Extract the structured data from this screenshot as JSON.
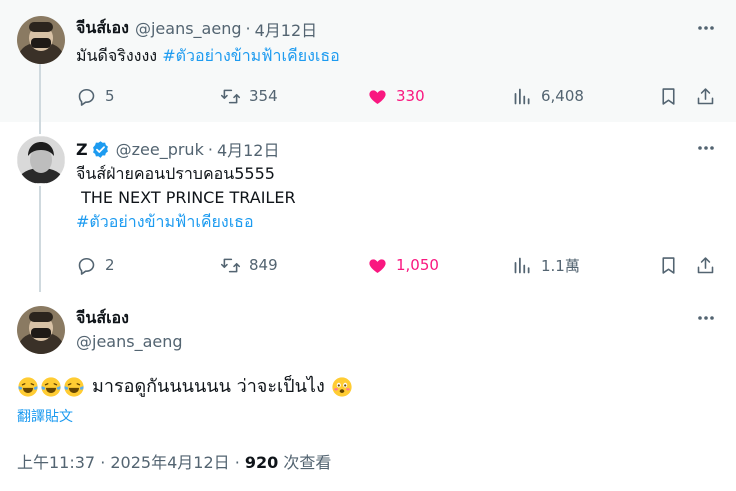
{
  "reply1": {
    "name": "จีนส์เอง",
    "handle": "@jeans_aeng",
    "date": "4月12日",
    "text": "มันดีจริงงงง",
    "hashtag": "#ตัวอย่างข้ามฟ้าเคียงเธอ",
    "replies": "5",
    "reposts": "354",
    "likes": "330",
    "views": "6,408"
  },
  "reply2": {
    "name": "Z",
    "handle": "@zee_pruk",
    "date": "4月12日",
    "line1": "จีนส์ฝ่ายคอนปราบคอน5555",
    "line2": " THE NEXT PRINCE TRAILER",
    "hashtag": "#ตัวอย่างข้ามฟ้าเคียงเธอ",
    "replies": "2",
    "reposts": "849",
    "likes": "1,050",
    "views": "1.1萬"
  },
  "main": {
    "name": "จีนส์เอง",
    "handle": "@jeans_aeng",
    "text": "มารอดูกันนนนนน ว่าจะเป็นไง",
    "translate": "翻譯貼文",
    "time": "上午11:37 · 2025年4月12日 · ",
    "views": "920",
    "views_label": " 次查看"
  },
  "separator": "·",
  "colors": {
    "link": "#1d9bf0",
    "like": "#f91880",
    "muted": "#536471"
  }
}
